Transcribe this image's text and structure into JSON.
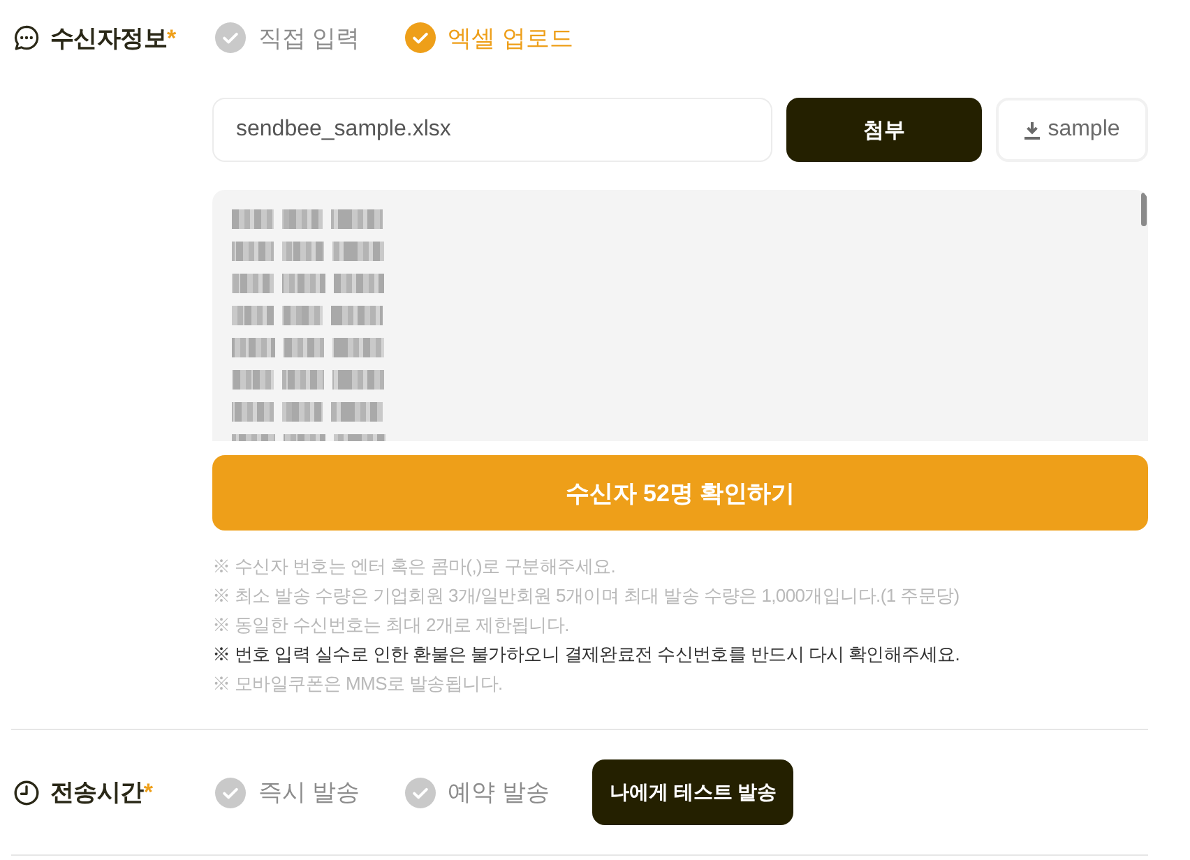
{
  "recipient_info": {
    "label": "수신자정보",
    "required_mark": "*",
    "input_methods": [
      {
        "label": "직접 입력",
        "selected": false
      },
      {
        "label": "엑셀 업로드",
        "selected": true
      }
    ],
    "file_field": {
      "value": "sendbee_sample.xlsx"
    },
    "attach_button": "첨부",
    "sample_button": "sample",
    "confirm_button": "수신자 52명 확인하기",
    "notes": [
      {
        "text": "※ 수신자 번호는 엔터 혹은 콤마(,)로 구분해주세요.",
        "emphasis": false
      },
      {
        "text": "※ 최소 발송 수량은 기업회원 3개/일반회원 5개이며 최대 발송 수량은 1,000개입니다.(1 주문당)",
        "emphasis": false
      },
      {
        "text": "※ 동일한 수신번호는 최대 2개로 제한됩니다.",
        "emphasis": false
      },
      {
        "text": "※ 번호 입력 실수로 인한 환불은 불가하오니 결제완료전 수신번호를 반드시 다시 확인해주세요.",
        "emphasis": true
      },
      {
        "text": "※ 모바일쿠폰은 MMS로 발송됩니다.",
        "emphasis": false
      }
    ]
  },
  "send_time": {
    "label": "전송시간",
    "required_mark": "*",
    "options": [
      {
        "label": "즉시 발송",
        "selected": false
      },
      {
        "label": "예약 발송",
        "selected": false
      }
    ],
    "test_button": "나에게 테스트 발송"
  }
}
